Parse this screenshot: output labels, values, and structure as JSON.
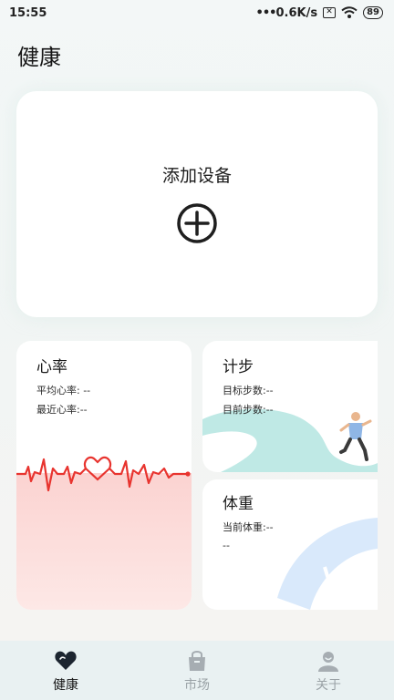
{
  "status": {
    "time": "15:55",
    "network": "0.6K/s",
    "sim": "✕",
    "battery": "89"
  },
  "page": {
    "title": "健康"
  },
  "add_device": {
    "label": "添加设备"
  },
  "heart_rate": {
    "title": "心率",
    "avg_label": "平均心率: --",
    "recent_label": "最近心率:--"
  },
  "steps": {
    "title": "计步",
    "target_label": "目标步数:--",
    "current_label": "目前步数:--"
  },
  "weight": {
    "title": "体重",
    "current_label": "当前体重:--",
    "extra": "--"
  },
  "tabs": [
    {
      "label": "健康",
      "icon": "heart-icon",
      "active": true
    },
    {
      "label": "市场",
      "icon": "shopping-bag-icon",
      "active": false
    },
    {
      "label": "关于",
      "icon": "person-icon",
      "active": false
    }
  ],
  "colors": {
    "accent": "#e8342f",
    "teal": "#bfe9e5",
    "blue": "#d9e9fb"
  }
}
